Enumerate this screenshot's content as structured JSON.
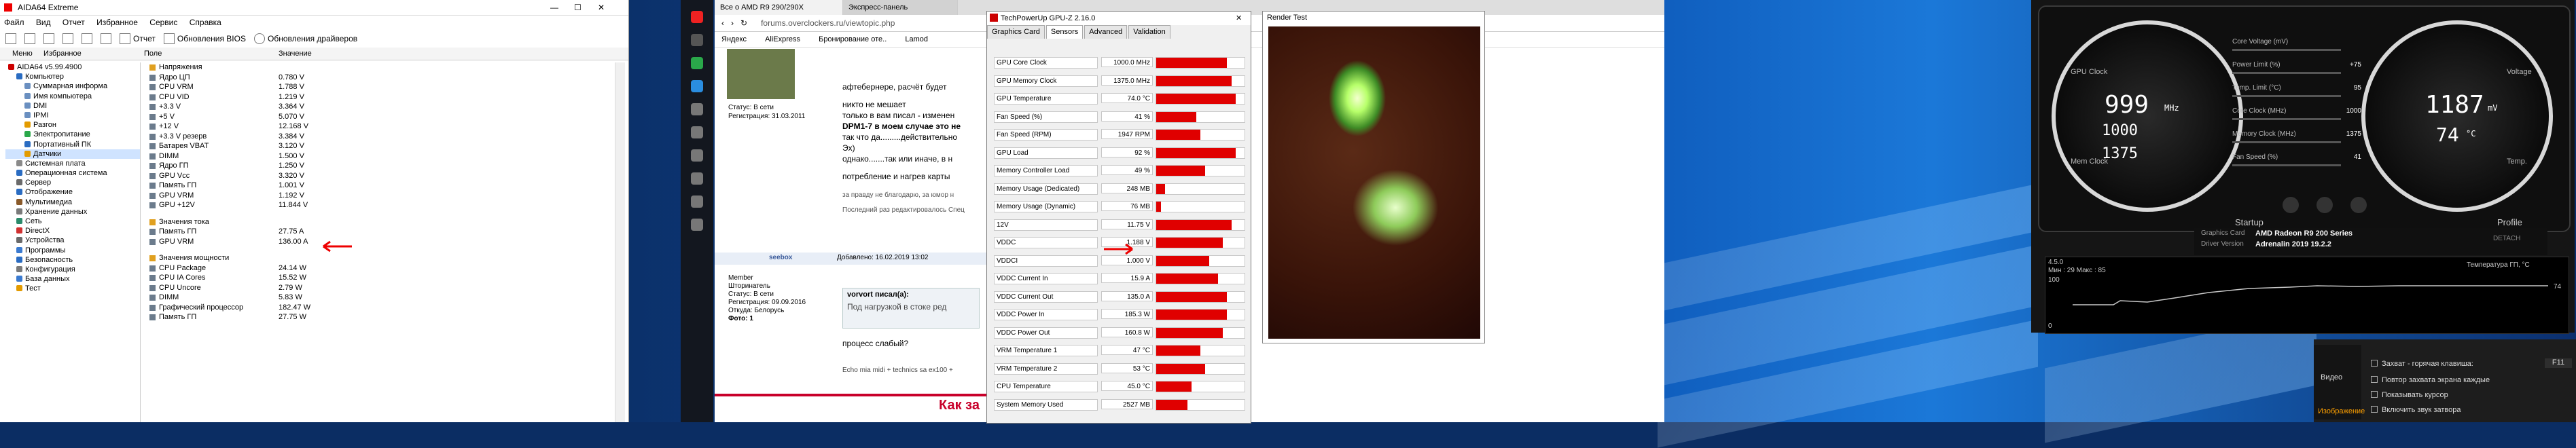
{
  "aida": {
    "title": "AIDA64 Extreme",
    "menu": [
      "Файл",
      "Вид",
      "Отчет",
      "Избранное",
      "Сервис",
      "Справка"
    ],
    "toolbar": {
      "report": "Отчет",
      "bios": "Обновления BIOS",
      "drivers": "Обновления драйверов"
    },
    "col_menu": "Меню",
    "col_favorites": "Избранное",
    "col_field": "Поле",
    "col_value": "Значение",
    "tree": [
      "AIDA64 v5.99.4900",
      "Компьютер",
      "Суммарная информа",
      "Имя компьютера",
      "DMI",
      "IPMI",
      "Разгон",
      "Электропитание",
      "Портативный ПК",
      "Датчики",
      "Системная плата",
      "Операционная система",
      "Сервер",
      "Отображение",
      "Мультимедиа",
      "Хранение данных",
      "Сеть",
      "DirectX",
      "Устройства",
      "Программы",
      "Безопасность",
      "Конфигурация",
      "База данных",
      "Тест"
    ],
    "section_voltage": "Напряжения",
    "voltages": [
      {
        "f": "Ядро ЦП",
        "v": "0.780 V"
      },
      {
        "f": "CPU VRM",
        "v": "1.788 V"
      },
      {
        "f": "CPU VID",
        "v": "1.219 V"
      },
      {
        "f": "+3.3 V",
        "v": "3.364 V"
      },
      {
        "f": "+5 V",
        "v": "5.070 V"
      },
      {
        "f": "+12 V",
        "v": "12.168 V"
      },
      {
        "f": "+3.3 V резерв",
        "v": "3.384 V"
      },
      {
        "f": "Батарея VBAT",
        "v": "3.120 V"
      },
      {
        "f": "DIMM",
        "v": "1.500 V"
      },
      {
        "f": "Ядро ГП",
        "v": "1.250 V"
      },
      {
        "f": "GPU Vcc",
        "v": "3.320 V"
      },
      {
        "f": "Память ГП",
        "v": "1.001 V"
      },
      {
        "f": "GPU VRM",
        "v": "1.192 V"
      },
      {
        "f": "GPU +12V",
        "v": "11.844 V"
      }
    ],
    "section_current": "Значения тока",
    "currents": [
      {
        "f": "Память ГП",
        "v": "27.75 A"
      },
      {
        "f": "GPU VRM",
        "v": "136.00 A"
      }
    ],
    "section_power": "Значения мощности",
    "powers": [
      {
        "f": "CPU Package",
        "v": "24.14 W"
      },
      {
        "f": "CPU IA Cores",
        "v": "15.52 W"
      },
      {
        "f": "CPU Uncore",
        "v": "2.79 W"
      },
      {
        "f": "DIMM",
        "v": "5.83 W"
      },
      {
        "f": "Графический процессор",
        "v": "182.47 W"
      },
      {
        "f": "Память ГП",
        "v": "27.75 W"
      }
    ]
  },
  "browser": {
    "tabs": [
      "Все о AMD R9 290/290X",
      "Экспресс-панель"
    ],
    "url": "forums.overclockers.ru/viewtopic.php",
    "bookmarks": [
      "Яндекс",
      "AliExpress",
      "Бронирование оте..",
      "Lamod"
    ],
    "post1_status": "Статус: В сети",
    "post1_reg": "Регистрация: 31.03.2011",
    "post1_text1": "афтебернере, расчёт будет",
    "post1_text2": "никто не мешает",
    "post1_text3": "только в вам писал - изменен",
    "post1_text4": "DPM1-7 в моем случае это не",
    "post1_text5": "так что да.........действительно",
    "post1_text6": "Эх)",
    "post1_text7": "однако.......так или иначе, в н",
    "post1_text8": "потребление и нагрев карты",
    "post1_text9": "за правду не благодарю, за юмор н",
    "post1_last": "Последний раз редактировалось Спец",
    "post2_user": "seebox",
    "post2_date": "Добавлено: 16.02.2019 13:02",
    "post2_role": "Member",
    "post2_label": "Шторинатель",
    "post2_status": "Статус: В сети",
    "post2_reg": "Регистрация: 09.09.2016",
    "post2_city": "Откуда: Белорусь",
    "post2_photos": "Фото: 1",
    "quote_author": "vorvort писал(а):",
    "quote_text": "Под нагрузкой в стоке ред",
    "reply": "процесс слабый?",
    "sig": "Echo mia midi + technics sa ex100 +",
    "bottom": "Как за"
  },
  "gpuz": {
    "title": "TechPowerUp GPU-Z 2.16.0",
    "tabs": [
      "Graphics Card",
      "Sensors",
      "Advanced",
      "Validation"
    ],
    "rows": [
      {
        "l": "GPU Core Clock",
        "v": "1000.0 MHz",
        "g": 0.8
      },
      {
        "l": "GPU Memory Clock",
        "v": "1375.0 MHz",
        "g": 0.85
      },
      {
        "l": "GPU Temperature",
        "v": "74.0 °C",
        "g": 0.9
      },
      {
        "l": "Fan Speed (%)",
        "v": "41 %",
        "g": 0.45
      },
      {
        "l": "Fan Speed (RPM)",
        "v": "1947 RPM",
        "g": 0.5
      },
      {
        "l": "GPU Load",
        "v": "92 %",
        "g": 0.9
      },
      {
        "l": "Memory Controller Load",
        "v": "49 %",
        "g": 0.55
      },
      {
        "l": "Memory Usage (Dedicated)",
        "v": "248 MB",
        "g": 0.1
      },
      {
        "l": "Memory Usage (Dynamic)",
        "v": "76 MB",
        "g": 0.05
      },
      {
        "l": "12V",
        "v": "11.75 V",
        "g": 0.85
      },
      {
        "l": "VDDC",
        "v": "1.188 V",
        "g": 0.75
      },
      {
        "l": "VDDCI",
        "v": "1.000 V",
        "g": 0.6
      },
      {
        "l": "VDDC Current In",
        "v": "15.9 A",
        "g": 0.7
      },
      {
        "l": "VDDC Current Out",
        "v": "135.0 A",
        "g": 0.8
      },
      {
        "l": "VDDC Power In",
        "v": "185.3 W",
        "g": 0.8
      },
      {
        "l": "VDDC Power Out",
        "v": "160.8 W",
        "g": 0.75
      },
      {
        "l": "VRM Temperature 1",
        "v": "47 °C",
        "g": 0.5
      },
      {
        "l": "VRM Temperature 2",
        "v": "53 °C",
        "g": 0.55
      },
      {
        "l": "CPU Temperature",
        "v": "45.0 °C",
        "g": 0.4
      },
      {
        "l": "System Memory Used",
        "v": "2527 MB",
        "g": 0.35
      }
    ]
  },
  "render": {
    "title": "Render Test"
  },
  "afterburner": {
    "gpu_clock_label": "GPU Clock",
    "mem_clock_label": "Mem Clock",
    "voltage_label": "Voltage",
    "temp_label": "Temp.",
    "clock_main": "999",
    "clock_unit": "MHz",
    "clock_boost": "1000",
    "clock_mem": "1375",
    "voltage_main": "1187",
    "voltage_unit": "mV",
    "temp_main": "74",
    "temp_unit": "°C",
    "sliders": [
      {
        "l": "Core Voltage (mV)",
        "v": ""
      },
      {
        "l": "Power Limit (%)",
        "v": "+75"
      },
      {
        "l": "Temp. Limit (°C)",
        "v": "95"
      },
      {
        "l": "Core Clock (MHz)",
        "v": "1000"
      },
      {
        "l": "Memory Clock (MHz)",
        "v": "1375"
      },
      {
        "l": "Fan Speed (%)",
        "v": "41"
      }
    ],
    "startup": "Startup",
    "profile": "Profile",
    "card_label": "Graphics Card",
    "card_name": "AMD Radeon R9 200 Series",
    "driver_label": "Driver Version",
    "driver_name": "Adrenalin 2019 19.2.2",
    "detach": "DETACH",
    "version": "4.5.0",
    "min_max": "Мин : 29  Макс : 85",
    "graph_label": "Температура ГП, °С",
    "graph_top": "100",
    "graph_val": "74",
    "graph_bottom": "0"
  },
  "settings": {
    "video": "Видео",
    "image": "Изображение",
    "hotkey_label": "Захват - горячая клавиша:",
    "hotkey_value": "F11",
    "opts": [
      "Повтор захвата экрана каждые",
      "Показывать курсор",
      "Включить звук затвора"
    ]
  }
}
